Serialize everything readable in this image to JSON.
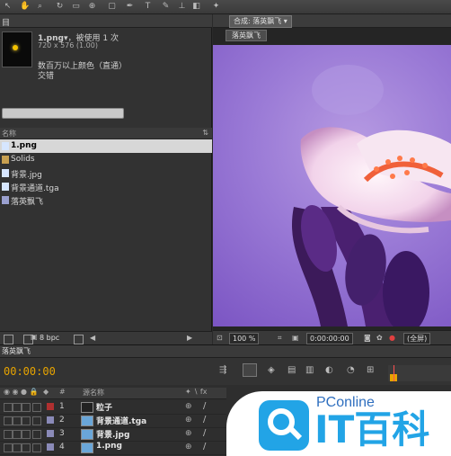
{
  "toolbar": {
    "icons": [
      "select-tool",
      "hand-tool",
      "zoom-tool",
      "rotate-tool",
      "camera-tool",
      "pan-tool",
      "mask-tool",
      "pen-tool",
      "text-tool",
      "brush-tool",
      "clone-tool",
      "eraser-tool",
      "puppet-tool"
    ]
  },
  "project": {
    "tab_label": "目",
    "thumbnail": {
      "name": "1.png▾",
      "usage": "，被使用 1 次",
      "dims": "720 x 576 (1.00)",
      "colors": "数百万以上颜色（直通）",
      "interlace": "交错"
    },
    "column_header": "名称",
    "items": [
      {
        "label": "1.png",
        "type": "png",
        "selected": true
      },
      {
        "label": "Solids",
        "type": "folder",
        "selected": false
      },
      {
        "label": "背景.jpg",
        "type": "jpg",
        "selected": false
      },
      {
        "label": "背景通道.tga",
        "type": "tga",
        "selected": false
      },
      {
        "label": "落英飘飞",
        "type": "comp",
        "selected": false
      }
    ],
    "bpc_label": "8 bpc"
  },
  "viewer": {
    "tab_label": "合成: 落英飘飞 ▾",
    "comp_tab": "落英飘飞",
    "zoom": "100 %",
    "timecode": "0:00:00:00",
    "resolution": "(全屏)"
  },
  "timeline": {
    "tab_label": "落英飘飞",
    "timecode": "00:00:00",
    "header_name": "源名称",
    "layers": [
      {
        "num": "1",
        "name": "粒子",
        "label_color": "#b03030",
        "icon": "solid"
      },
      {
        "num": "2",
        "name": "背景通道.tga",
        "label_color": "#8a8ab8",
        "icon": "image"
      },
      {
        "num": "3",
        "name": "背景.jpg",
        "label_color": "#8a8ab8",
        "icon": "image"
      },
      {
        "num": "4",
        "name": "1.png",
        "label_color": "#8a8ab8",
        "icon": "image"
      }
    ]
  },
  "watermark": {
    "brand": "PConline",
    "title": "IT百科"
  },
  "colors": {
    "accent_timecode": "#e8a400",
    "selection": "#d7d7d7"
  }
}
